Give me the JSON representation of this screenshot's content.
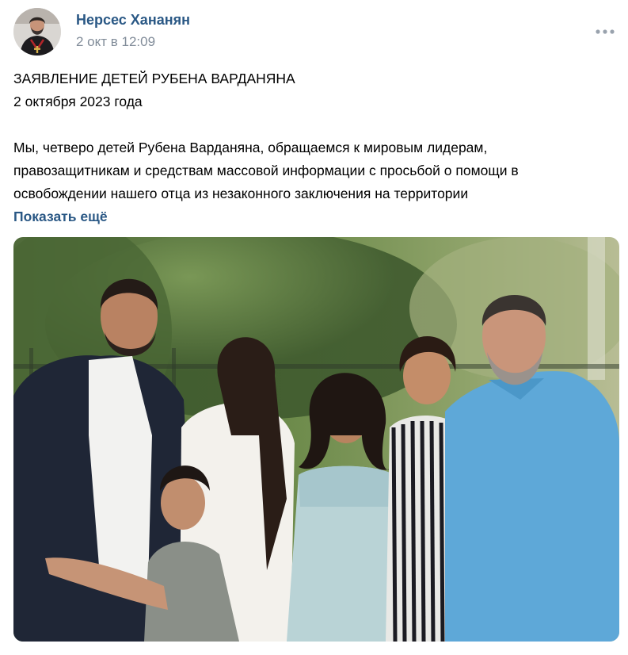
{
  "post": {
    "author": "Нерсес Хананян",
    "date": "2 окт в 12:09",
    "icons": {
      "avatar": "priest-portrait",
      "more": "more-horizontal-icon"
    },
    "body": {
      "title_line": "ЗАЯВЛЕНИЕ ДЕТЕЙ РУБЕНА ВАРДАНЯНА",
      "date_line": "2 октября 2023 года",
      "paragraph_lines": [
        "Мы, четверо детей Рубена Варданяна, обращаемся к мировым лидерам,",
        "правозащитникам и средствам массовой информации с просьбой о помощи в",
        "освобождении нашего отца из незаконного заключения на территории"
      ],
      "show_more": "Показать ещё"
    },
    "photo": {
      "subject": "family-group-photo"
    }
  },
  "colors": {
    "link": "#2a5885",
    "muted": "#818c99",
    "text": "#000000"
  }
}
